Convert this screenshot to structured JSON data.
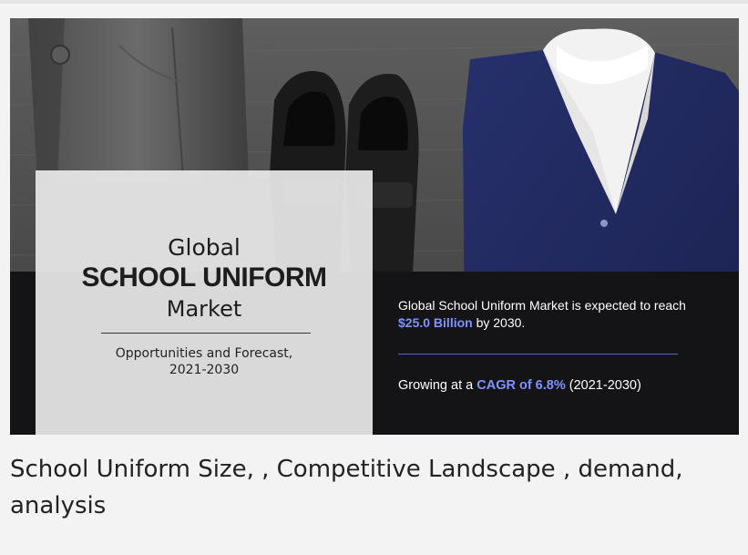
{
  "banner": {
    "panel": {
      "global": "Global",
      "title": "SCHOOL UNIFORM",
      "market": "Market",
      "subtitle_line1": "Opportunities and Forecast,",
      "subtitle_line2": "2021-2030"
    },
    "stats": {
      "line1_text_a": "Global School Uniform Market is expected to reach ",
      "line1_value": "$25.0 Billion",
      "line1_text_b": " by 2030.",
      "line2_text_a": "Growing at a ",
      "line2_value": "CAGR of 6.8%",
      "line2_text_b": " (2021-2030)"
    },
    "highlight_color": "#7d93ff"
  },
  "caption": "School Uniform Size, , Competitive Landscape , demand, analysis"
}
